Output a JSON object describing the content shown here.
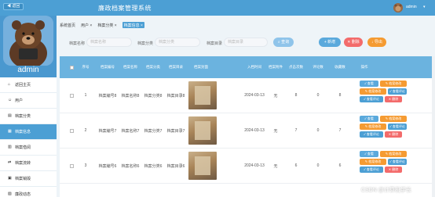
{
  "topbar": {
    "back_label": "◀ 返回",
    "title": "廉政档案管理系统",
    "user": "admin"
  },
  "sidebar": {
    "admin_name": "admin",
    "items": [
      {
        "label": "返回主页",
        "icon": "home-icon"
      },
      {
        "label": "用户",
        "icon": "user-icon"
      },
      {
        "label": "档案分类",
        "icon": "folder-icon"
      },
      {
        "label": "档案信息",
        "icon": "grid-icon"
      },
      {
        "label": "档案借阅",
        "icon": "book-icon"
      },
      {
        "label": "档案流转",
        "icon": "flow-icon"
      },
      {
        "label": "档案销毁",
        "icon": "trash-icon"
      },
      {
        "label": "廉政动态",
        "icon": "news-icon"
      }
    ]
  },
  "crumbs": [
    {
      "label": "系统首页"
    },
    {
      "label": "用户 ×"
    },
    {
      "label": "档案分类 ×"
    },
    {
      "label": "档案信息 ×"
    }
  ],
  "search": {
    "name_label": "档案名称",
    "name_placeholder": "档案名称",
    "cat_label": "档案分类",
    "cat_placeholder": "档案分类",
    "dir_label": "档案目录",
    "dir_placeholder": "档案目录",
    "search_btn": "查询",
    "add_btn": "+ 新增",
    "delete_btn": "✕ 删除",
    "export_btn": "↓ 导出"
  },
  "table": {
    "headers": [
      "",
      "序号",
      "档案编号",
      "档案名称",
      "档案分类",
      "档案目录",
      "档案封面",
      "入档时间",
      "档案附件",
      "点击次数",
      "评论数",
      "收藏数",
      "操作"
    ],
    "rows": [
      {
        "index": "1",
        "code": "档案编号8",
        "name": "档案名称8",
        "category": "档案分类8",
        "directory": "档案目录8",
        "date": "2024-03-13",
        "attachment": "无",
        "clicks": "8",
        "comments": "0",
        "favorites": "8"
      },
      {
        "index": "2",
        "code": "档案编号7",
        "name": "档案名称7",
        "category": "档案分类7",
        "directory": "档案目录7",
        "date": "2024-03-13",
        "attachment": "无",
        "clicks": "7",
        "comments": "0",
        "favorites": "7"
      },
      {
        "index": "3",
        "code": "档案编号6",
        "name": "档案名称6",
        "category": "档案分类6",
        "directory": "档案目录6",
        "date": "2024-03-13",
        "attachment": "无",
        "clicks": "6",
        "comments": "0",
        "favorites": "6"
      }
    ],
    "actions": {
      "view": "✓ 查看",
      "modify": "✎ 档案修改",
      "update": "✎ 档案修改",
      "comment": "✓ 查看评论",
      "delete": "✕ 删除"
    }
  },
  "watermark": "CSDN @计算机学长"
}
